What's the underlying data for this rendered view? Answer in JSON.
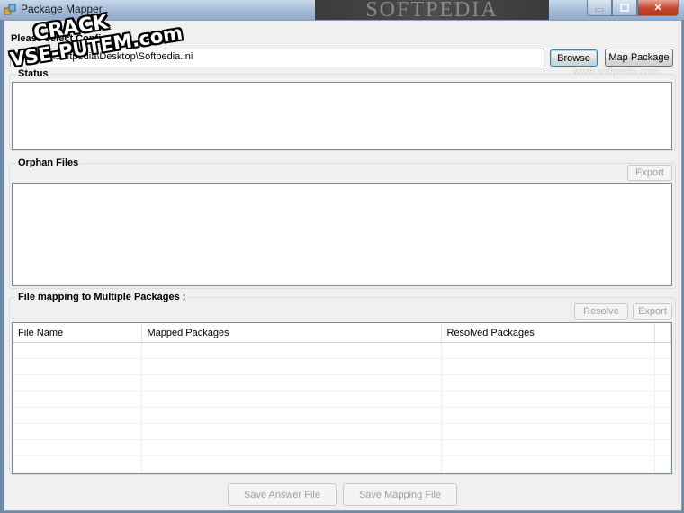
{
  "window": {
    "title": "Package Mapper",
    "watermark": "SOFTPEDIA",
    "controls": {
      "minimize": "",
      "maximize": "",
      "close": "✕"
    }
  },
  "config": {
    "prompt_label": "Please select Config File :",
    "file_path": "C:\\Users\\Softpedia\\Desktop\\Softpedia.ini",
    "browse_label": "Browse",
    "map_package_label": "Map Package"
  },
  "status_group": {
    "title": "Status"
  },
  "orphan_files": {
    "title": "Orphan Files",
    "export_label": "Export"
  },
  "multi_mapping": {
    "title": "File mapping to Multiple Packages :",
    "resolve_label": "Resolve",
    "export_label": "Export",
    "columns": [
      "File Name",
      "Mapped Packages",
      "Resolved Packages"
    ],
    "rows": []
  },
  "footer": {
    "save_answer_label": "Save Answer File",
    "save_mapping_label": "Save Mapping File"
  },
  "overlay": {
    "stamp_line1": "CRACK",
    "stamp_line2": "VSE-PUTEM.com",
    "softpedia_text": "www.softpedia.com"
  },
  "colors": {
    "titlebar": "#a9c0da",
    "client": "#f0f0f0",
    "close": "#c4452e"
  }
}
